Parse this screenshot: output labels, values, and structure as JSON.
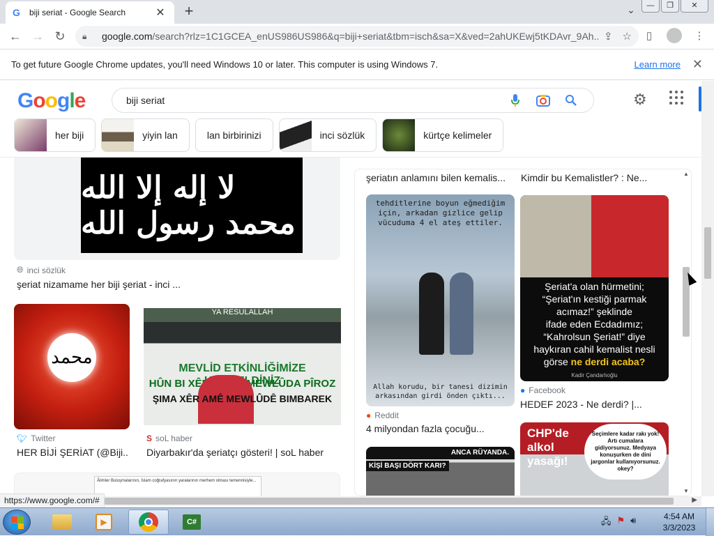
{
  "tab": {
    "title": "biji seriat - Google Search",
    "favicon": "G",
    "close": "✕",
    "new_tab": "+"
  },
  "window_controls": {
    "minimize": "—",
    "restore": "❐",
    "close": "✕"
  },
  "toolbar": {
    "back": "←",
    "forward": "→",
    "reload": "↻",
    "url_host": "google.com",
    "url_rest": "/search?rlz=1C1GCEA_enUS986US986&q=biji+seriat&tbm=isch&sa=X&ved=2ahUKEwj5tKDAvr_9Ah..."
  },
  "infobar": {
    "message": "To get future Google Chrome updates, you'll need Windows 10 or later. This computer is using Windows 7.",
    "learn_more": "Learn more",
    "close": "✕"
  },
  "google": {
    "logo_letters": [
      "G",
      "o",
      "o",
      "g",
      "l",
      "e"
    ],
    "logo_colors": [
      "#4285f4",
      "#ea4335",
      "#fbbc05",
      "#4285f4",
      "#34a853",
      "#ea4335"
    ],
    "query": "biji seriat",
    "chips": [
      {
        "label": "her biji",
        "thumb_color": "#e8e2d4"
      },
      {
        "label": "yiyin lan",
        "thumb_color": "#d6d2cc"
      },
      {
        "label": "lan birbirinizi"
      },
      {
        "label": "inci sözlük",
        "thumb_color": "#5a5a5a"
      },
      {
        "label": "kürtçe kelimeler",
        "thumb_color": "#2a3a2a"
      }
    ]
  },
  "results": {
    "left": [
      {
        "image_text": "لا إله إلا الله محمد رسول الله",
        "source": "inci sözlük",
        "caption": "şeriat nizamame her biji şeriat - inci ..."
      },
      {
        "image_text": "محمد",
        "source": "Twitter",
        "caption": "HER BİJİ ŞERİAT (@Biji..."
      },
      {
        "ribbon": "YA RESULALLAH",
        "banner1": "MEVLİD ETKİNLİĞİMİZE HOŞGELDİNİZ",
        "banner2": "HÛN BI XÊR HATIN MEWLÛDA PÎROZ",
        "banner3": "ŞIMA XÊR AMÊ MEWLÛDÊ BIMBAREK",
        "source": "soL haber",
        "caption": "Diyarbakır'da şeriatçı gösteri! | soL haber"
      },
      {
        "image_text": "Âlimler Buluşmalarının, İslam coğrafyasının yaralarının merhem olması temennisiyle..."
      }
    ],
    "panel": {
      "top_captions": [
        "şeriatın anlamını bilen kemalis...",
        "Kimdir bu Kemalistler? : Ne..."
      ],
      "items": [
        {
          "top_text": "tehditlerine boyun eğmediğim için, arkadan gizlice gelip vücuduma 4 el ateş ettiler.",
          "bottom_text": "Allah korudu, bir tanesi dizimin arkasından girdi önden çıktı...",
          "source": "Reddit",
          "caption": "4 milyondan fazla çocuğu..."
        },
        {
          "text_lines": [
            "Şeriat'a olan hürmetini;",
            "“Şeriat'ın kestiği parmak acımaz!” şeklinde",
            "ifade eden Ecdadımız;",
            "“Kahrolsun Şeriat!” diye",
            "haykıran cahil kemalist nesli",
            "görse"
          ],
          "highlight": "ne derdi acaba?",
          "signature": "Kadir Çandarlıoğlu",
          "source": "Facebook",
          "caption": "HEDEF 2023 - Ne derdi? |..."
        },
        {
          "header": "ANCA RÜYANDA.",
          "label": "KİŞİ BAŞI DÖRT KARI?"
        },
        {
          "title": "CHP'de alkol yasağı!",
          "bubble": "Seçimlere kadar rakı yok! Artı cumalara gidiyorsunuz. Medyaya konuşurken de dini jargonlar kullanıyorsunuz. okey?"
        }
      ]
    }
  },
  "status_link": "https://www.google.com/#",
  "taskbar": {
    "time": "4:54 AM",
    "date": "3/3/2023",
    "cs_label": "C#"
  }
}
